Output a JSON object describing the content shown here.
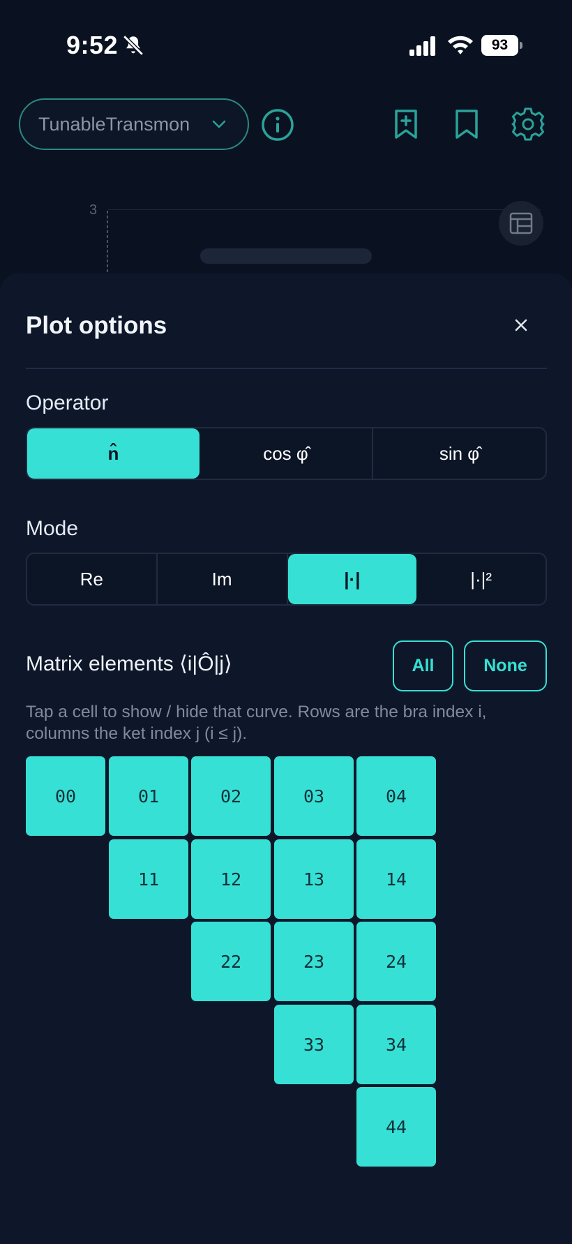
{
  "status_bar": {
    "time": "9:52",
    "battery_level": "93",
    "icons": [
      "bell-slash-icon",
      "cellular-signal-icon",
      "wifi-icon",
      "battery-icon"
    ]
  },
  "header": {
    "device_select_value": "TunableTransmon",
    "icons": [
      "chevron-down-icon",
      "info-icon",
      "bookmark-add-icon",
      "bookmark-icon",
      "gear-icon"
    ]
  },
  "plot": {
    "y_tick": "3",
    "table_icon": "table-icon"
  },
  "sheet": {
    "title": "Plot options",
    "close_icon": "close-icon",
    "operator": {
      "label": "Operator",
      "options": [
        "n̂",
        "cos φ̂",
        "sin φ̂"
      ],
      "selected": "n̂"
    },
    "mode": {
      "label": "Mode",
      "options": [
        "Re",
        "Im",
        "|·|",
        "|·|²"
      ],
      "selected": "|·|"
    },
    "matrix": {
      "title": "Matrix elements ⟨i|Ô|j⟩",
      "all_label": "All",
      "none_label": "None",
      "help": "Tap a cell to show / hide that curve. Rows are the bra index i, columns the ket index j (i ≤ j).",
      "rows": [
        [
          "00",
          "01",
          "02",
          "03",
          "04"
        ],
        [
          "11",
          "12",
          "13",
          "14"
        ],
        [
          "22",
          "23",
          "24"
        ],
        [
          "33",
          "34"
        ],
        [
          "44"
        ]
      ],
      "accent": "#36e0d4"
    }
  },
  "colors": {
    "background": "#0a1221",
    "sheet": "#0e1729",
    "accent": "#36e0d4",
    "header_icon": "#2aa39a"
  }
}
